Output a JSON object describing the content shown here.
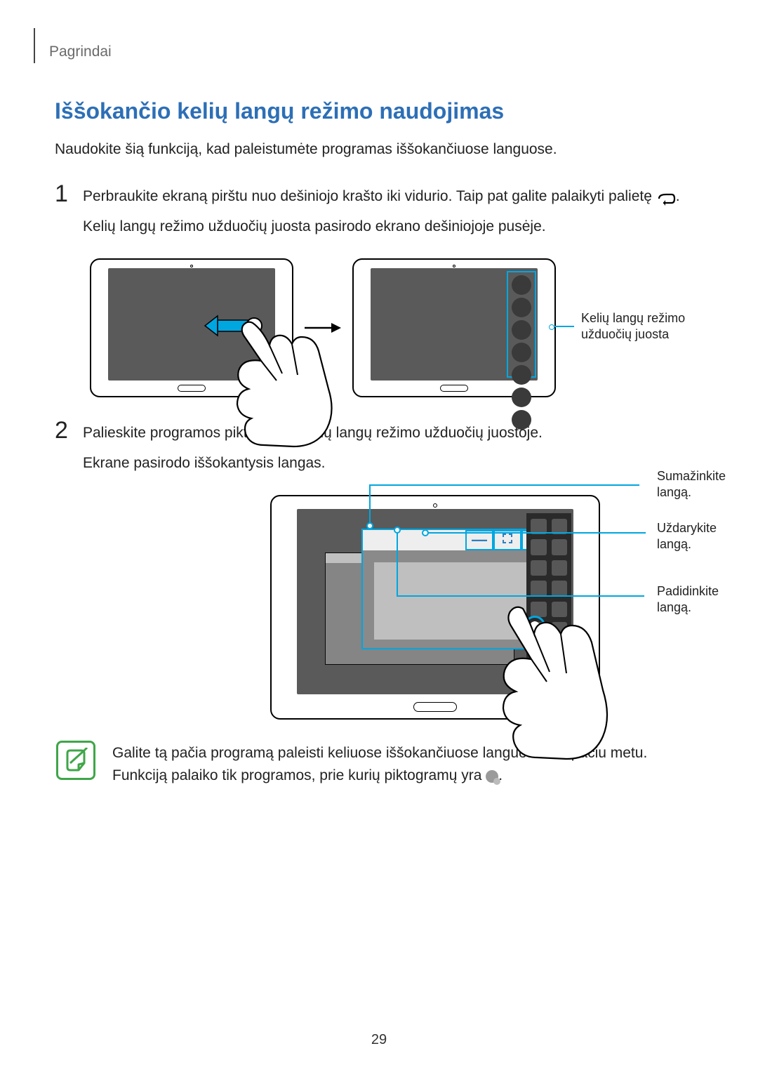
{
  "header": {
    "section": "Pagrindai"
  },
  "title": "Iššokančio kelių langų režimo naudojimas",
  "intro": "Naudokite šią funkciją, kad paleistumėte programas iššokančiuose languose.",
  "steps": {
    "s1": {
      "num": "1",
      "line1_before": "Perbraukite ekraną pirštu nuo dešiniojo krašto iki vidurio. Taip pat galite palaikyti palietę ",
      "line1_after": ".",
      "line2": "Kelių langų režimo užduočių juosta pasirodo ekrano dešiniojoje pusėje."
    },
    "s2": {
      "num": "2",
      "line1": "Palieskite programos piktogramą kelių langų režimo užduočių juostoje.",
      "line2": "Ekrane pasirodo iššokantysis langas."
    }
  },
  "fig1": {
    "callout": "Kelių langų režimo\nužduočių juosta"
  },
  "fig2": {
    "c1": "Sumažinkite\nlangą.",
    "c2": "Uždarykite\nlangą.",
    "c3": "Padidinkite\nlangą."
  },
  "note": {
    "line1": "Galite tą pačia programą paleisti keliuose iššokančiuose languose tuo pačiu metu.",
    "line2_before": "Funkciją palaiko tik programos, prie kurių piktogramų yra ",
    "line2_after": "."
  },
  "page_number": "29"
}
